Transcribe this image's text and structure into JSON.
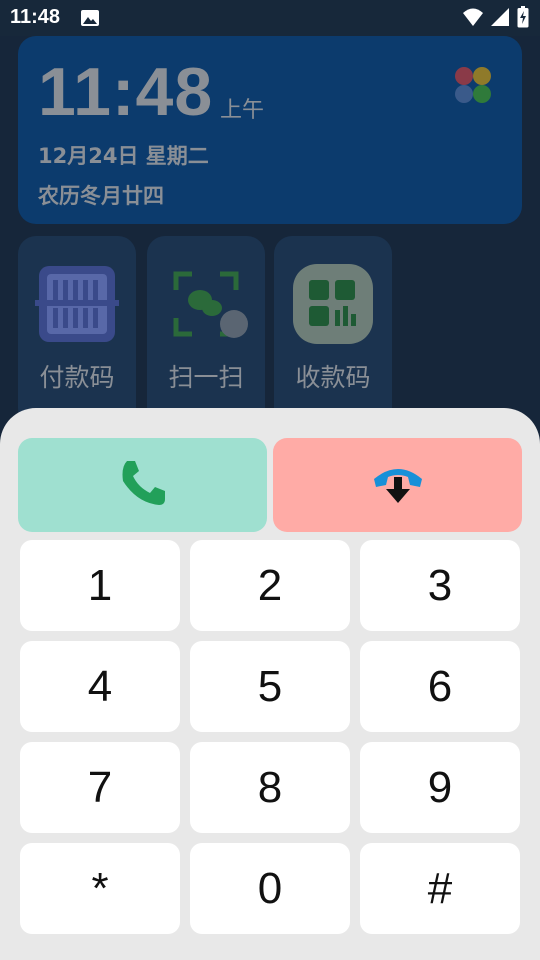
{
  "status_bar": {
    "time": "11:48",
    "icons": [
      "gallery-icon",
      "wifi-icon",
      "signal-icon",
      "battery-charging-icon"
    ]
  },
  "clock_widget": {
    "time": "11:48",
    "ampm": "上午",
    "date": "12月24日  星期二",
    "lunar": "农历冬月廿四",
    "logo": "petal-logo-icon"
  },
  "shortcuts": [
    {
      "label": "付款码",
      "icon": "barcode-scan-icon"
    },
    {
      "label": "扫一扫",
      "icon": "wechat-scan-icon"
    },
    {
      "label": "收款码",
      "icon": "qr-receive-icon"
    }
  ],
  "call_buttons": {
    "answer_icon": "phone-answer-icon",
    "hangup_icon": "phone-hangup-icon",
    "answer_color": "#9fe0d0",
    "hangup_color": "#ffaba6"
  },
  "keypad": [
    "1",
    "2",
    "3",
    "4",
    "5",
    "6",
    "7",
    "8",
    "9",
    "*",
    "0",
    "#"
  ]
}
